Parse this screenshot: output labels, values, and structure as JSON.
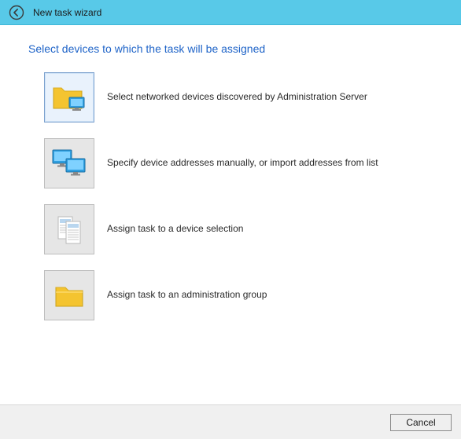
{
  "window": {
    "title": "New task wizard"
  },
  "heading": "Select devices to which the task will be assigned",
  "options": [
    {
      "label": "Select networked devices discovered by Administration Server",
      "icon": "folder-monitor",
      "selected": true
    },
    {
      "label": "Specify device addresses manually, or import addresses from list",
      "icon": "two-monitors",
      "selected": false
    },
    {
      "label": "Assign task to a device selection",
      "icon": "documents",
      "selected": false
    },
    {
      "label": "Assign task to an administration group",
      "icon": "folder",
      "selected": false
    }
  ],
  "buttons": {
    "cancel": "Cancel"
  }
}
